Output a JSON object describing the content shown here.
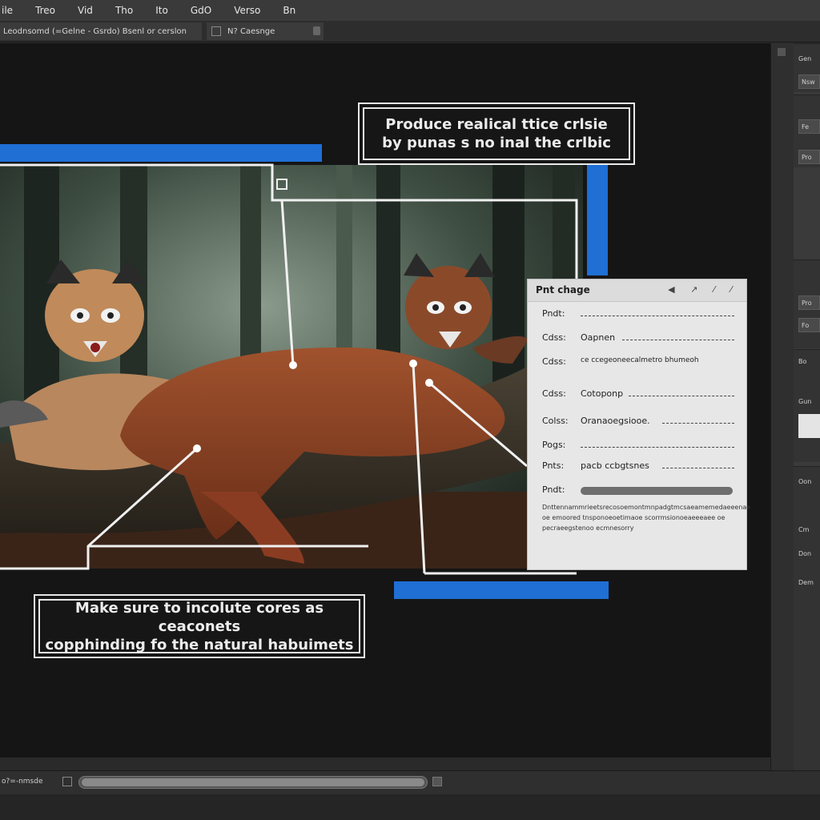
{
  "menu": [
    {
      "label": "ile"
    },
    {
      "label": "Treo"
    },
    {
      "label": "Vid"
    },
    {
      "label": "Tho"
    },
    {
      "label": "Ito"
    },
    {
      "label": "GdO"
    },
    {
      "label": "Verso"
    },
    {
      "label": "Bn"
    }
  ],
  "tabs": [
    {
      "label": "Leodnsomd (=Gelne - Gsrdo) Bsenl or cerslon"
    },
    {
      "label": "N? Caesnge"
    }
  ],
  "callouts": {
    "top": {
      "line1": "Produce realical ttice crlsie",
      "line2": "by punas s no inal the crlbic"
    },
    "bottom": {
      "line1": "Make sure to incolute cores as ceaconets",
      "line2": "copphinding fo the natural habuimets"
    }
  },
  "properties_panel": {
    "title": "Pnt chage",
    "header_icons": "◀ ↗ ⁄ ⁄",
    "rows": [
      {
        "label": "Pndt:",
        "value": ""
      },
      {
        "label": "Cdss:",
        "value": "Oapnen"
      },
      {
        "label": "Cdss:",
        "value": "ce ccegeoneecalmetro bhumeoh"
      },
      {
        "label": "Cdss:",
        "value": "Cotoponp"
      },
      {
        "label": "Colss:",
        "value": "Oranaoegsiooe."
      },
      {
        "label": "Pogs:",
        "value": ""
      },
      {
        "label": "Pnts:",
        "value": "pacb ccbgtsnes"
      },
      {
        "label": "Pndt:",
        "value": ""
      }
    ],
    "slider_fraction": 1.0,
    "description": "Dnttennammrieetsrecosoemontmnpadgtmcsaeamemedaeeenae oe emoored tnsponoeoetimaoe scorrmsionoeaeeeaee oe pecraeegstenoo ecmnesorry"
  },
  "dock": {
    "labels": [
      "Gen",
      "Nsw",
      "Fe",
      "Pro",
      "Pro",
      "Fo",
      "Bo",
      "Gun",
      "Oon",
      "Cm",
      "Don",
      "Dem"
    ]
  },
  "status": {
    "label": "o?=-nmsde"
  },
  "colors": {
    "accent_blue": "#1f6fd4",
    "callout_border": "#e8e8e8",
    "canvas_bg": "#151515"
  }
}
